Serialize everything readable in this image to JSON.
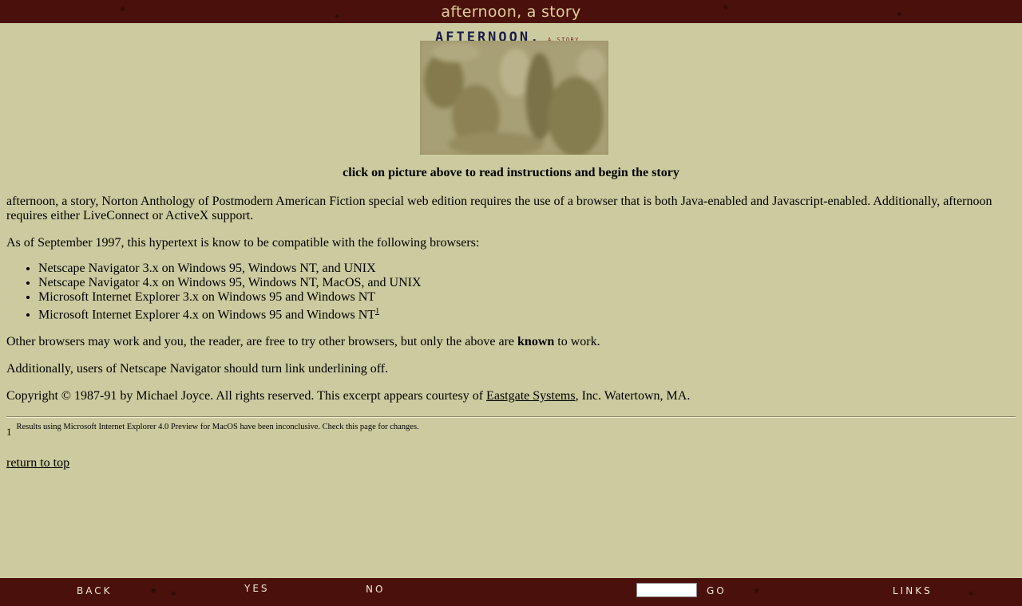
{
  "header": {
    "title": "afternoon, a story"
  },
  "banner": {
    "title": "AFTERNOON,",
    "subtitle": "A STORY"
  },
  "instructions": "click on picture above to read instructions and begin the story",
  "intro": "afternoon, a story, Norton Anthology of Postmodern American Fiction special web edition requires the use of a browser that is both Java-enabled and Javascript-enabled. Additionally, afternoon requires either LiveConnect or ActiveX support.",
  "compat_intro": "As of September 1997, this hypertext is know to be compatible with the following browsers:",
  "browsers": [
    "Netscape Navigator 3.x on Windows 95, Windows NT, and UNIX",
    "Netscape Navigator 4.x on Windows 95, Windows NT, MacOS, and UNIX",
    "Microsoft Internet Explorer 3.x on Windows 95 and Windows NT",
    "Microsoft Internet Explorer 4.x on Windows 95 and Windows NT"
  ],
  "footnote_marker": "1",
  "other_before": "Other browsers may work and you, the reader, are free to try other browsers, but only the above are ",
  "other_bold": "known",
  "other_after": " to work.",
  "underline_note": "Additionally, users of Netscape Navigator should turn link underlining off.",
  "copyright_before": "Copyright © 1987-91 by Michael Joyce. All rights reserved. This excerpt appears courtesy of ",
  "copyright_link": "Eastgate Systems",
  "copyright_after": ", Inc. Watertown, MA.",
  "footnote": {
    "num": "1",
    "text": "Results using Microsoft Internet Explorer 4.0 Preview for MacOS have been inconclusive. Check this page for changes."
  },
  "return_link": "return to top",
  "bottom_nav": {
    "back": "BACK",
    "yes": "YES",
    "no": "NO",
    "go": "GO",
    "links": "LINKS",
    "go_value": ""
  },
  "colors": {
    "bar_bg": "#4a100b",
    "page_bg": "#cccba0",
    "title_text": "#e1cf9a"
  }
}
